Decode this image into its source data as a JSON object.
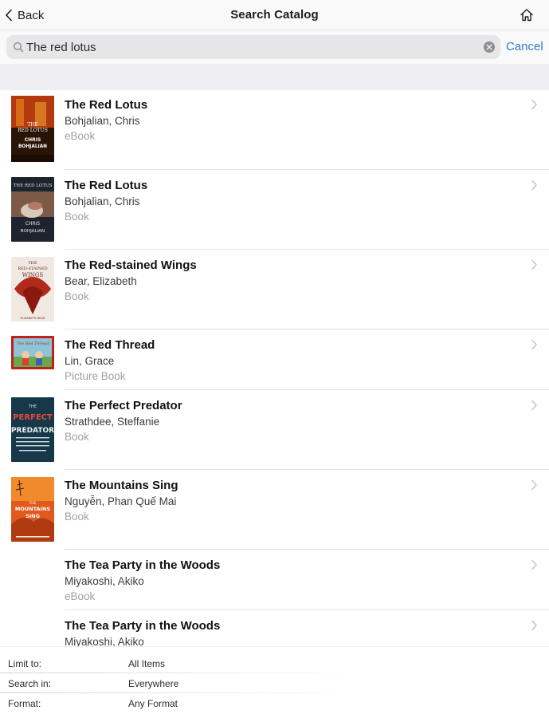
{
  "nav": {
    "back_label": "Back",
    "title": "Search Catalog",
    "home_icon": "home-icon"
  },
  "search": {
    "value": "The red lotus",
    "cancel_label": "Cancel"
  },
  "colors": {
    "accent": "#2f7bd6",
    "separator": "#e3e3e5",
    "secondary_text": "#a1a1a5"
  },
  "results": [
    {
      "title": "The Red Lotus",
      "author": "Bohjalian, Chris",
      "format": "eBook",
      "cover": "red-lotus-ebook-cover"
    },
    {
      "title": "The Red Lotus",
      "author": "Bohjalian, Chris",
      "format": "Book",
      "cover": "red-lotus-book-cover"
    },
    {
      "title": "The Red-stained Wings",
      "author": "Bear, Elizabeth",
      "format": "Book",
      "cover": "red-stained-wings-cover"
    },
    {
      "title": "The Red Thread",
      "author": "Lin, Grace",
      "format": "Picture Book",
      "cover": "red-thread-cover"
    },
    {
      "title": "The Perfect Predator",
      "author": "Strathdee, Steffanie",
      "format": "Book",
      "cover": "perfect-predator-cover"
    },
    {
      "title": "The Mountains Sing",
      "author": "Nguyễn, Phan Quế Mai",
      "format": "Book",
      "cover": "mountains-sing-cover"
    },
    {
      "title": "The Tea Party in the Woods",
      "author": "Miyakoshi, Akiko",
      "format": "eBook",
      "cover": ""
    },
    {
      "title": "The Tea Party in the Woods",
      "author": "Miyakoshi, Akiko",
      "format": "",
      "cover": ""
    }
  ],
  "filters": [
    {
      "label": "Limit to:",
      "value": "All Items"
    },
    {
      "label": "Search in:",
      "value": "Everywhere"
    },
    {
      "label": "Format:",
      "value": "Any Format"
    }
  ]
}
